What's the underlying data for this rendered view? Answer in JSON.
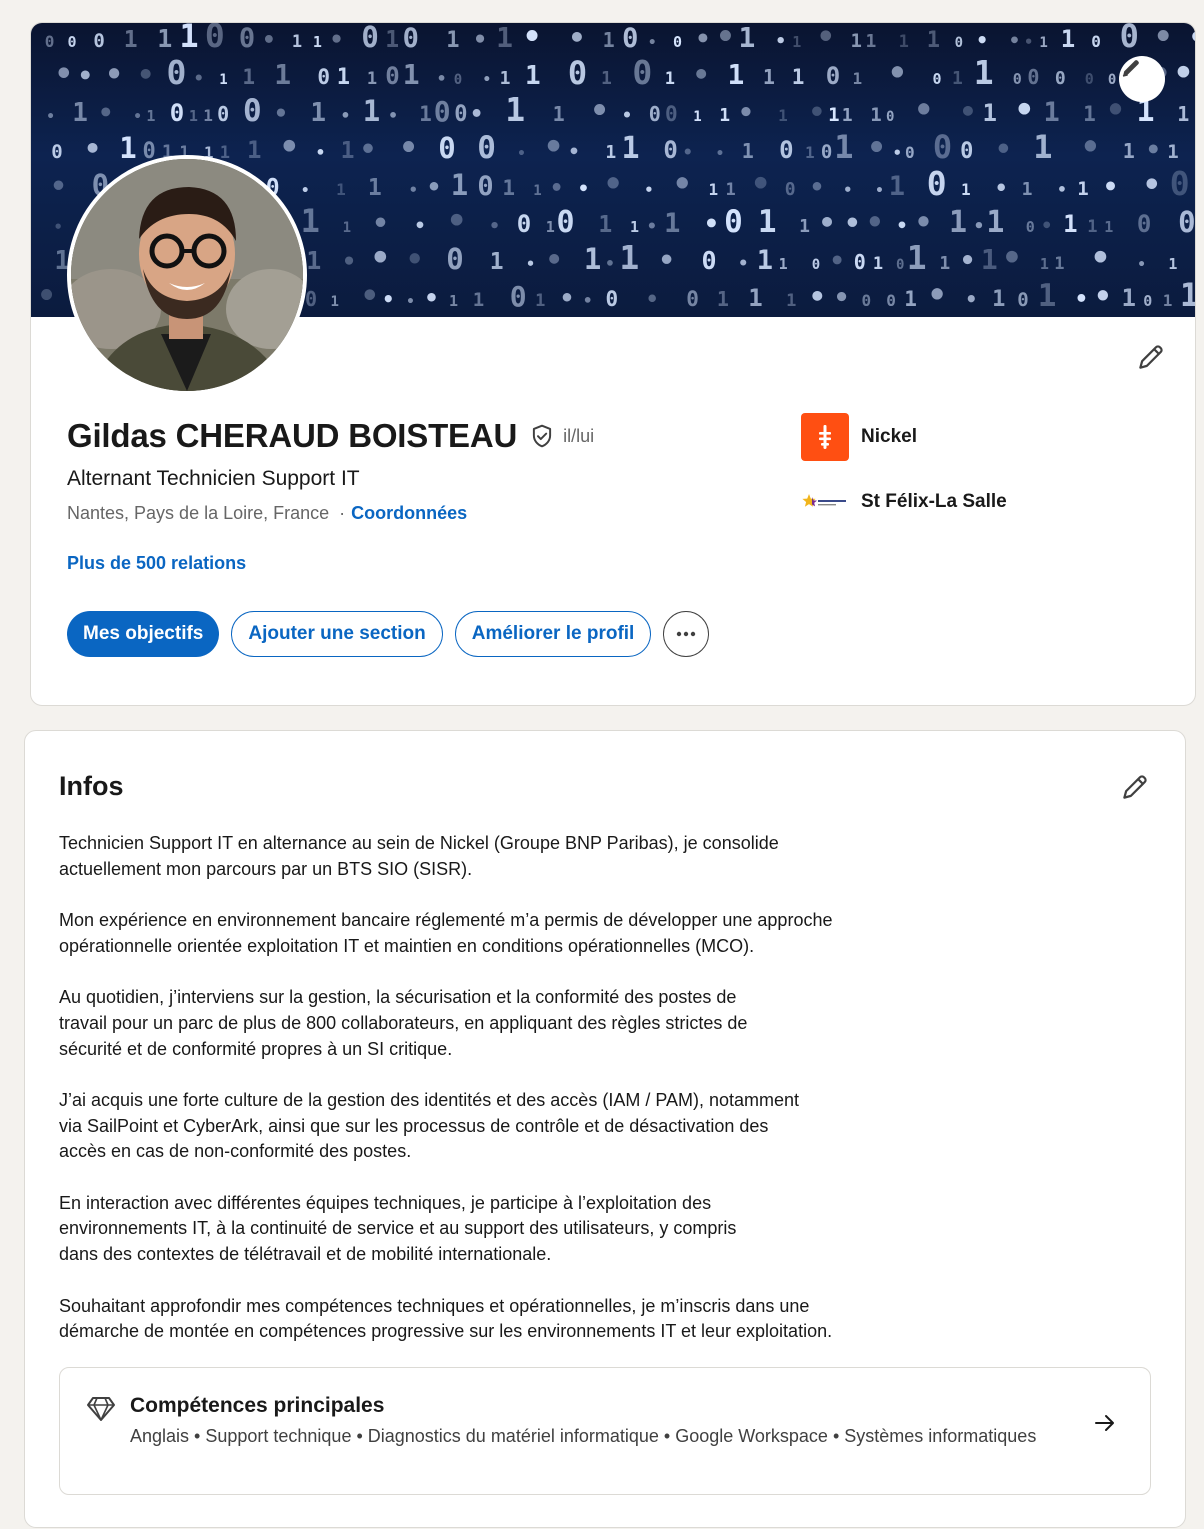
{
  "profile": {
    "name": "Gildas CHERAUD BOISTEAU",
    "pronouns": "il/lui",
    "headline": "Alternant Technicien Support IT",
    "location": "Nantes, Pays de la Loire, France",
    "location_separator": "·",
    "contact_link": "Coordonnées",
    "connections": "Plus de 500 relations",
    "organizations": [
      {
        "name": "Nickel",
        "logo": "nickel-logo"
      },
      {
        "name": "St Félix-La Salle",
        "logo": "st-felix-la-salle-logo"
      }
    ],
    "actions": {
      "primary": "Mes objectifs",
      "add_section": "Ajouter une section",
      "improve_profile": "Améliorer le profil",
      "more_icon": "more-horizontal-icon"
    },
    "icons": {
      "banner_edit": "pencil-icon",
      "intro_edit": "pencil-icon",
      "verified": "verified-shield-icon"
    }
  },
  "about": {
    "title": "Infos",
    "paragraphs": [
      "Technicien Support IT en alternance au sein de Nickel (Groupe BNP Paribas), je consolide\nactuellement mon parcours par un BTS SIO (SISR).",
      "Mon expérience en environnement bancaire réglementé m’a permis de développer une approche\nopérationnelle orientée exploitation IT et maintien en conditions opérationnelles (MCO).",
      "Au quotidien, j’interviens sur la gestion, la sécurisation et la conformité des postes de\ntravail pour un parc de plus de 800 collaborateurs, en appliquant des règles strictes de\nsécurité et de conformité propres à un SI critique.",
      "J’ai acquis une forte culture de la gestion des identités et des accès (IAM / PAM), notamment\nvia SailPoint et CyberArk, ainsi que sur les processus de contrôle et de désactivation des\naccès en cas de non-conformité des postes.",
      "En interaction avec différentes équipes techniques, je participe à l’exploitation des\nenvironnements IT, à la continuité de service et au support des utilisateurs, y compris\ndans des contextes de télétravail et de mobilité internationale.",
      "Souhaitant approfondir mes compétences techniques et opérationnelles, je m’inscris dans une\ndémarche de montée en compétences progressive sur les environnements IT et leur exploitation."
    ],
    "skills": {
      "title": "Compétences principales",
      "list": "Anglais • Support technique • Diagnostics du matériel informatique • Google Workspace • Systèmes informatiques",
      "icon": "diamond-icon",
      "arrow_icon": "arrow-right-icon"
    }
  },
  "colors": {
    "brand": "#0a66c2",
    "page_bg": "#f4f2ee",
    "nickel": "#ff4f12"
  }
}
